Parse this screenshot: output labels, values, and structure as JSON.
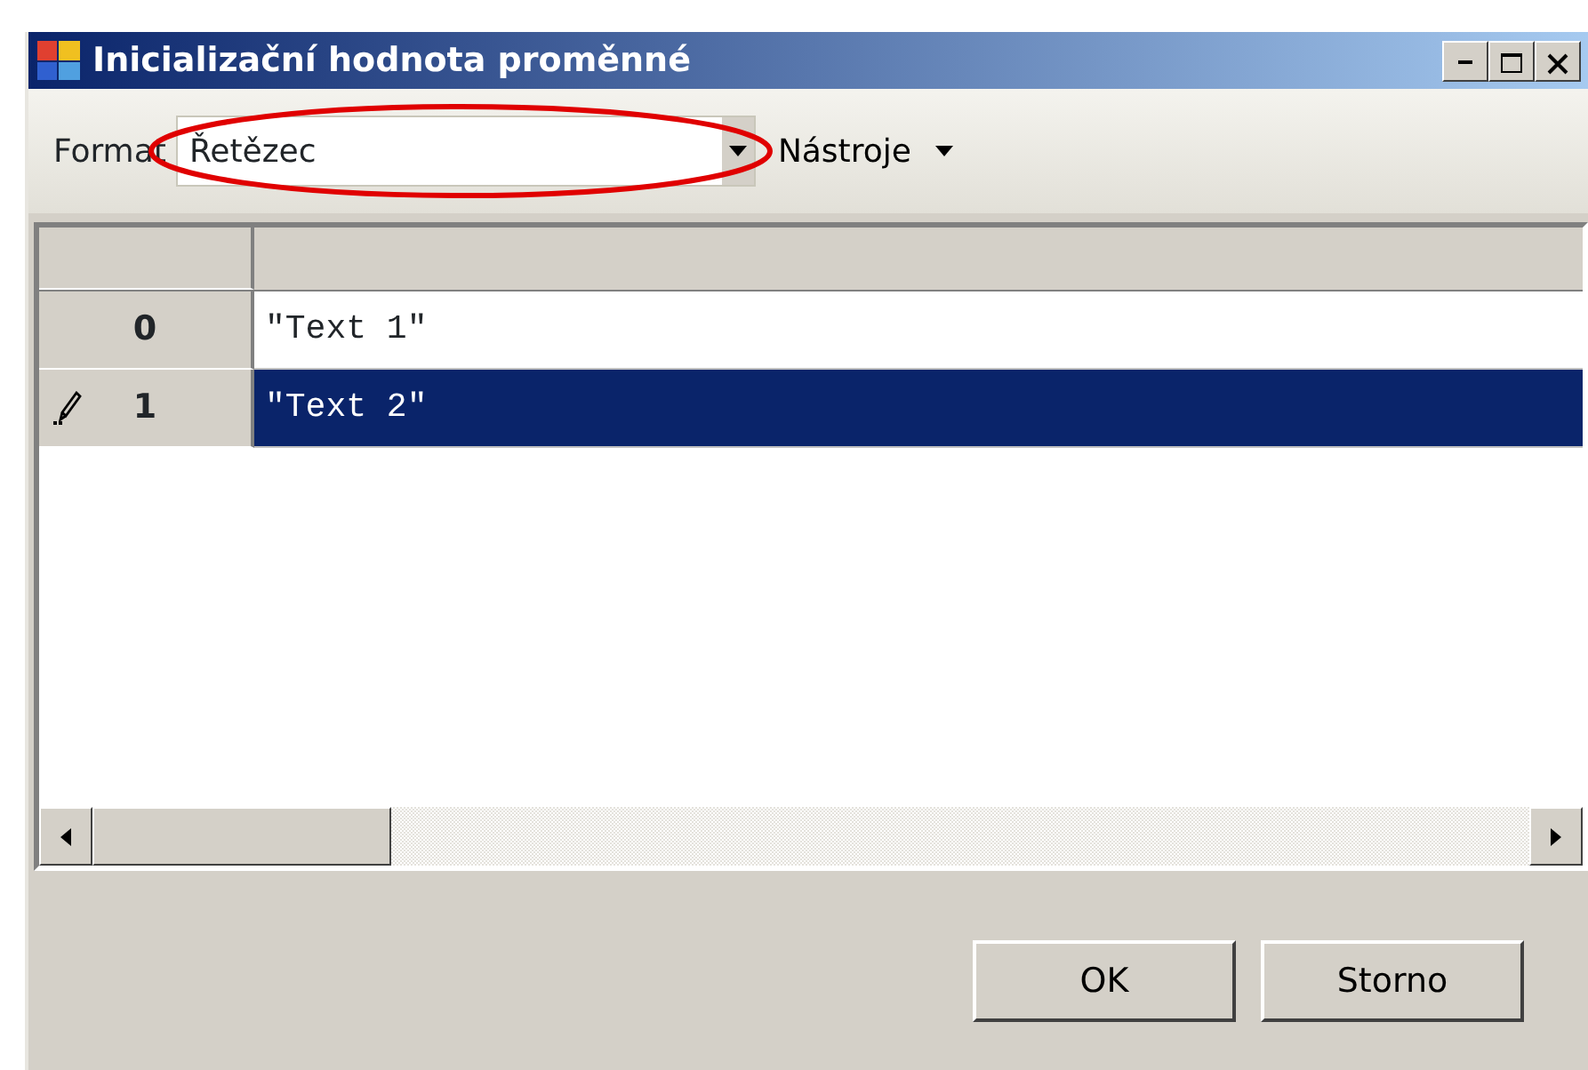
{
  "window": {
    "title": "Inicializační hodnota proměnné"
  },
  "toolbar": {
    "format_label": "Format",
    "format_value": "Řetězec",
    "tools_label": "Nástroje"
  },
  "grid": {
    "rows": [
      {
        "index": "0",
        "value": "\"Text 1\"",
        "selected": false,
        "editing": false
      },
      {
        "index": "1",
        "value": "\"Text 2\"",
        "selected": true,
        "editing": true
      }
    ]
  },
  "buttons": [
    "OK",
    "Storno"
  ]
}
